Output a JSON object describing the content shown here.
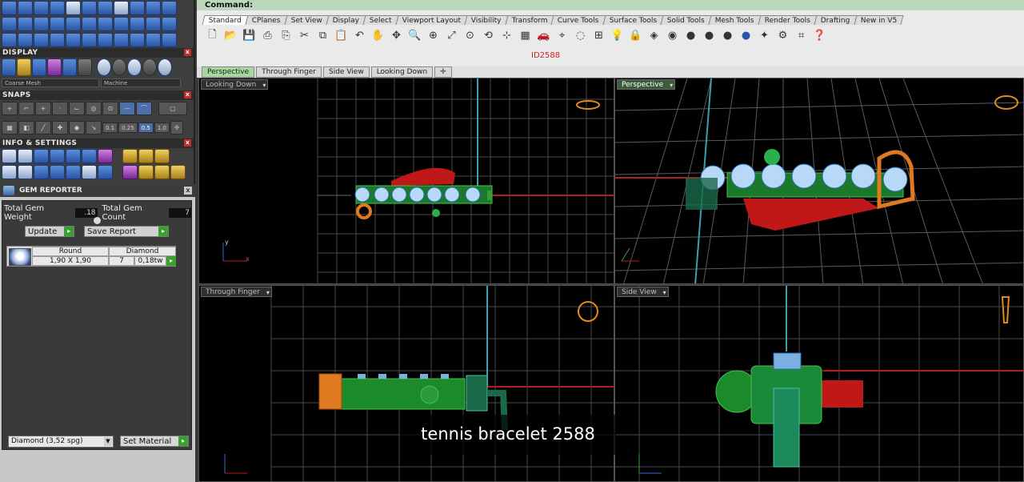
{
  "command_bar": {
    "label": "Command:"
  },
  "left_panel": {
    "display": {
      "header": "DISPLAY",
      "combo_left": "Coarse Mesh",
      "combo_right": "Machine"
    },
    "snaps": {
      "header": "SNAPS",
      "tolerances": [
        "0.1",
        "0.25",
        "0.5",
        "1.0"
      ],
      "selected_tolerance": "0.5"
    },
    "info": {
      "header": "INFO & SETTINGS"
    }
  },
  "gem_reporter": {
    "title": "GEM REPORTER",
    "total_weight_label": "Total Gem Weight",
    "total_weight_value": ".18",
    "total_count_label": "Total Gem Count",
    "total_count_value": "7",
    "update_label": "Update",
    "save_label": "Save Report",
    "table": {
      "col1_header": "Round",
      "col2_header": "Diamond",
      "size": "1,90 X 1,90",
      "count": "7",
      "weight": "0,18tw"
    },
    "material_select": "Diamond    (3,52 spg)",
    "set_material_label": "Set Material"
  },
  "toolbar_tabs": [
    "Standard",
    "CPlanes",
    "Set View",
    "Display",
    "Select",
    "Viewport Layout",
    "Visibility",
    "Transform",
    "Curve Tools",
    "Surface Tools",
    "Solid Tools",
    "Mesh Tools",
    "Render Tools",
    "Drafting",
    "New in V5"
  ],
  "active_toolbar_tab": "Standard",
  "id_label": "ID2588",
  "viewport_tabs": [
    "Perspective",
    "Through Finger",
    "Side View",
    "Looking Down"
  ],
  "viewports": {
    "top_left": "Looking Down",
    "top_right": "Perspective",
    "bottom_left": "Through Finger",
    "bottom_right": "Side View"
  },
  "overlay_caption": "tennis bracelet 2588",
  "colors": {
    "accent_green": "#3aa030",
    "id_red": "#d02020",
    "grid": "#4a4a4a"
  }
}
